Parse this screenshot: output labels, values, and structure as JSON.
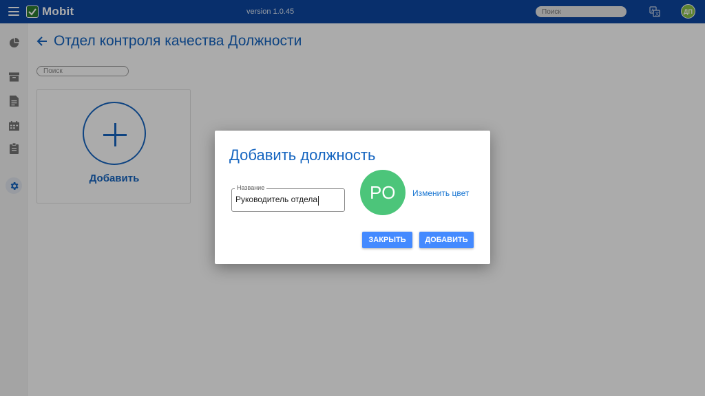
{
  "app": {
    "name": "Mobit",
    "version": "version 1.0.45",
    "search_placeholder": "Поиск",
    "user_initials": "ДП"
  },
  "sidebar": {
    "items": [
      {
        "icon": "pie-chart-icon"
      },
      {
        "icon": "archive-icon"
      },
      {
        "icon": "document-icon"
      },
      {
        "icon": "calendar-icon"
      },
      {
        "icon": "clipboard-icon"
      },
      {
        "icon": "gear-icon",
        "active": true
      }
    ]
  },
  "page": {
    "title": "Отдел контроля качества Должности",
    "search_placeholder": "Поиск",
    "add_card_label": "Добавить"
  },
  "dialog": {
    "title": "Добавить должность",
    "field_label": "Название",
    "field_value": "Руководитель отдела",
    "avatar_initials": "РО",
    "avatar_color": "#4cc57a",
    "change_color_label": "Изменить цвет",
    "close_button": "ЗАКРЫТЬ",
    "add_button": "ДОБАВИТЬ"
  },
  "colors": {
    "topbar": "#0d47a1",
    "accent": "#1565c0",
    "button": "#448aff"
  }
}
